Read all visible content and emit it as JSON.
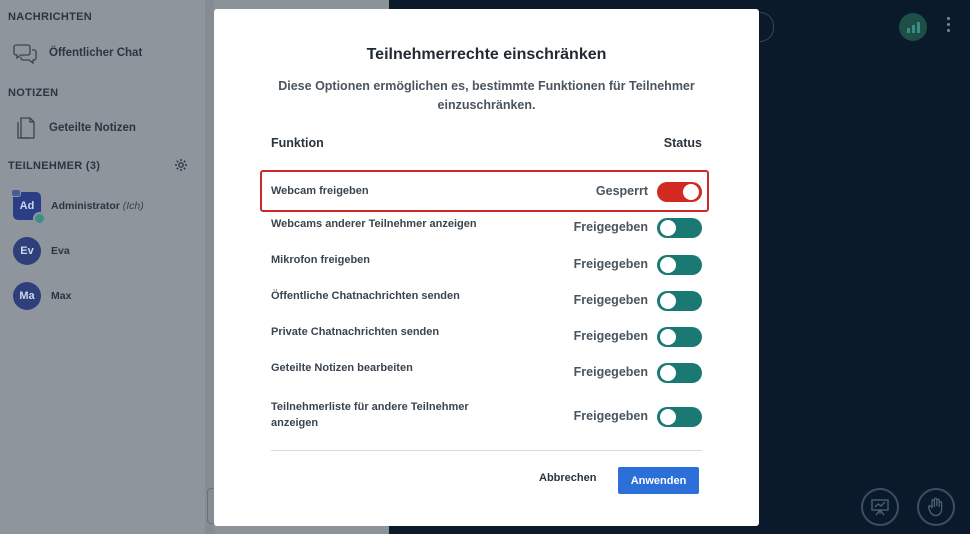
{
  "sidebar": {
    "messages_title": "NACHRICHTEN",
    "public_chat": "Öffentlicher Chat",
    "notes_title": "NOTIZEN",
    "shared_notes": "Geteilte Notizen",
    "participants_title": "TEILNEHMER (3)",
    "users": [
      {
        "initials": "Ad",
        "name": "Administrator",
        "suffix": "(Ich)"
      },
      {
        "initials": "Ev",
        "name": "Eva"
      },
      {
        "initials": "Ma",
        "name": "Max"
      }
    ]
  },
  "modal": {
    "title": "Teilnehmerrechte einschränken",
    "description": "Diese Optionen ermöglichen es, bestimmte Funktionen für Teilnehmer einzuschränken.",
    "col_function": "Funktion",
    "col_status": "Status",
    "rows": [
      {
        "label": "Webcam freigeben",
        "status": "Gesperrt",
        "locked": true
      },
      {
        "label": "Webcams anderer Teilnehmer anzeigen",
        "status": "Freigegeben",
        "locked": false
      },
      {
        "label": "Mikrofon freigeben",
        "status": "Freigegeben",
        "locked": false
      },
      {
        "label": "Öffentliche Chatnachrichten senden",
        "status": "Freigegeben",
        "locked": false
      },
      {
        "label": "Private Chatnachrichten senden",
        "status": "Freigegeben",
        "locked": false
      },
      {
        "label": "Geteilte Notizen bearbeiten",
        "status": "Freigegeben",
        "locked": false
      },
      {
        "label": "Teilnehmerliste für andere Teilnehmer anzeigen",
        "status": "Freigegeben",
        "locked": false
      }
    ],
    "cancel_label": "Abbrechen",
    "apply_label": "Anwenden"
  },
  "colors": {
    "locked": "#d22a20",
    "unlocked": "#1a7a73",
    "primary_button": "#2c6fd8",
    "highlight_border": "#cc2a2a"
  },
  "icons": [
    "chat-icon",
    "notes-icon",
    "gear-icon",
    "connection-status-icon",
    "more-options-icon",
    "presentation-icon",
    "raise-hand-icon"
  ]
}
